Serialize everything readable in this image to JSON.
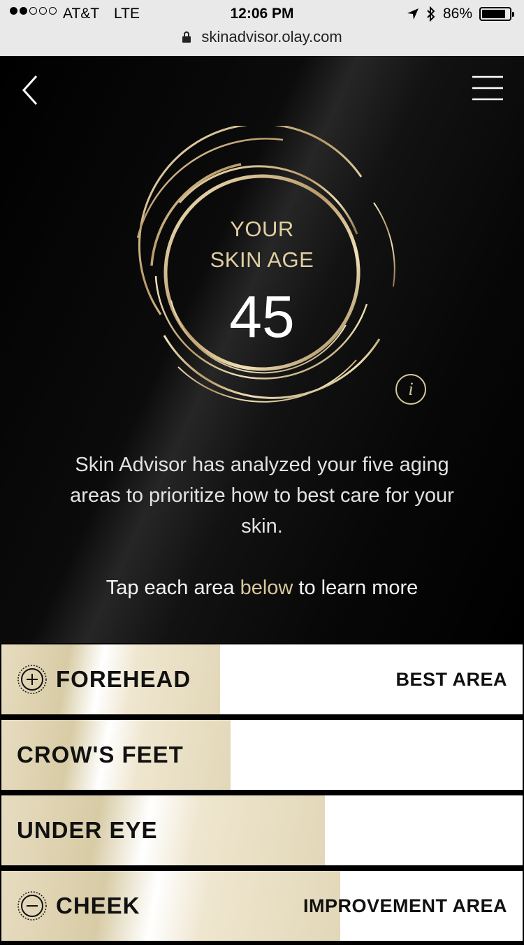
{
  "status_bar": {
    "carrier": "AT&T",
    "network": "LTE",
    "time": "12:06 PM",
    "battery": "86%",
    "battery_level": 0.86,
    "url": "skinadvisor.olay.com"
  },
  "nav": {
    "back_icon": "chevron-left-icon",
    "menu_icon": "hamburger-menu-icon"
  },
  "result": {
    "label_line1": "YOUR",
    "label_line2": "SKIN AGE",
    "age": "45",
    "info_glyph": "i"
  },
  "description": "Skin Advisor has analyzed your five aging areas to prioritize how to best care for your skin.",
  "tap_hint": {
    "before": "Tap each area ",
    "highlight": "below",
    "after": " to learn more"
  },
  "areas": [
    {
      "name": "FOREHEAD",
      "tag": "BEST AREA",
      "icon": "plus-circle-icon",
      "level": 0.42
    },
    {
      "name": "CROW'S FEET",
      "tag": "",
      "icon": "",
      "level": 0.44
    },
    {
      "name": "UNDER EYE",
      "tag": "",
      "icon": "",
      "level": 0.62
    },
    {
      "name": "CHEEK",
      "tag": "IMPROVEMENT AREA",
      "icon": "minus-circle-icon",
      "level": 0.65
    }
  ],
  "colors": {
    "gold": "#d8c79b",
    "background": "#000000"
  }
}
